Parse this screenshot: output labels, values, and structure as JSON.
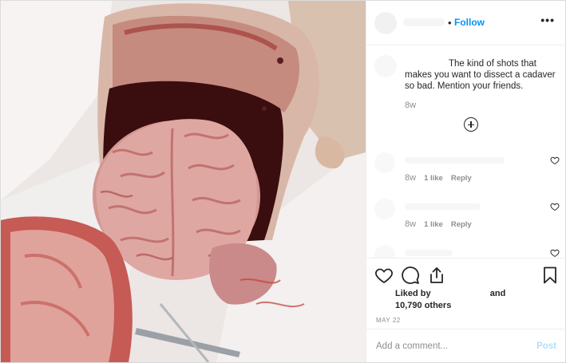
{
  "post": {
    "follow_separator": "•",
    "follow_label": "Follow",
    "more_label": "•••",
    "image_alt": "photo",
    "caption": "The kind of shots that makes you want to dissect a cadaver so bad. Mention your friends.",
    "caption_time": "8w",
    "comments": [
      {
        "time": "8w",
        "likes": "1 like",
        "reply": "Reply"
      },
      {
        "time": "8w",
        "likes": "1 like",
        "reply": "Reply"
      }
    ],
    "liked_by_prefix": "Liked by",
    "liked_by_and": "and",
    "liked_by_others": "10,790 others",
    "date": "MAY 22",
    "comment_placeholder": "Add a comment...",
    "post_label": "Post",
    "colors": {
      "follow": "#0095f6",
      "post_disabled": "#b2dffc",
      "muted": "#8e8e8e"
    },
    "icons": [
      "heart-icon",
      "comment-icon",
      "share-icon",
      "bookmark-icon",
      "plus-circle-icon",
      "more-icon"
    ]
  }
}
